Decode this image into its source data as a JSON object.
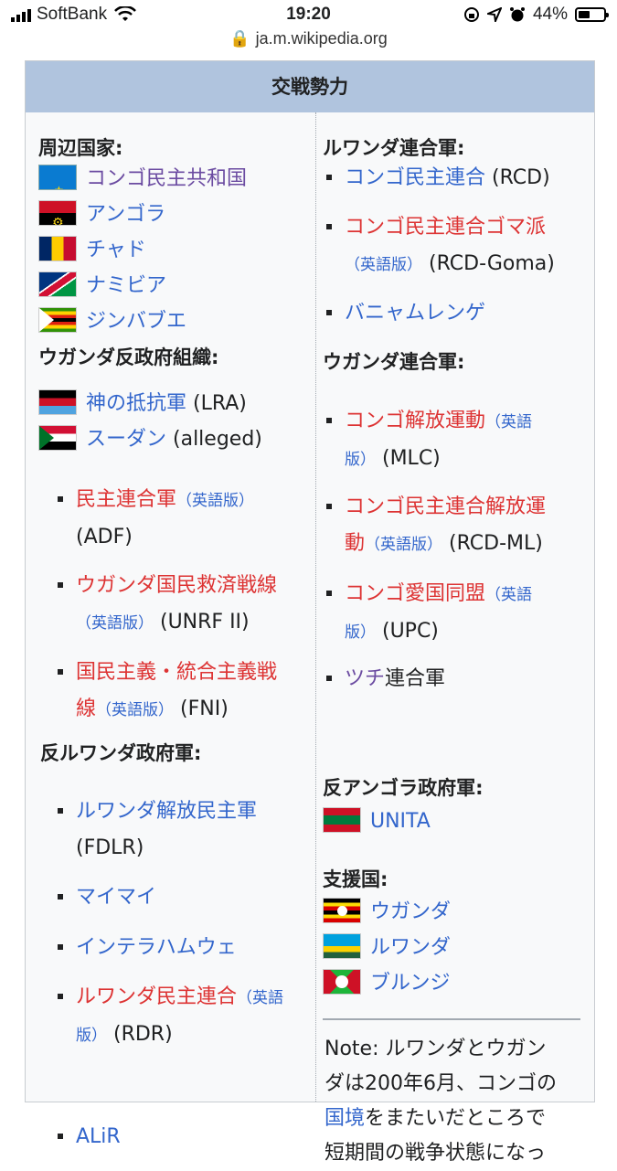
{
  "statusbar": {
    "carrier": "SoftBank",
    "time": "19:20",
    "battery": "44%",
    "url": "ja.m.wikipedia.org"
  },
  "infobox": {
    "header": "交戦勢力",
    "left": {
      "neighbors_header": "周辺国家:",
      "neighbors": [
        {
          "name": "コンゴ民主共和国",
          "flag": "drc-flag"
        },
        {
          "name": "アンゴラ",
          "flag": "angola-flag"
        },
        {
          "name": "チャド",
          "flag": "chad-flag"
        },
        {
          "name": "ナミビア",
          "flag": "namibia-flag"
        },
        {
          "name": "ジンバブエ",
          "flag": "zimbabwe-flag"
        }
      ],
      "ugandan_rebels_header": "ウガンダ反政府組織:",
      "lra": {
        "name": "神の抵抗軍",
        "suffix": " (LRA)"
      },
      "sudan": {
        "name": "スーダン",
        "suffix": " (alleged)"
      },
      "adf": {
        "line1": "民主連合軍",
        "en": "（英語版）",
        "line2": "(ADF)"
      },
      "unrf": {
        "line1": "ウガンダ国民救済戦線",
        "en": "（英語版）",
        "line2": " (UNRF II)"
      },
      "fni": {
        "line1": "国民主義・統合主義戦",
        "line2": "線",
        "en": "（英語版）",
        "tail": " (FNI)"
      },
      "anti_rwanda_header": "反ルワンダ政府軍:",
      "fdlr": {
        "line1": "ルワンダ解放民主軍",
        "line2": "(FDLR)"
      },
      "maimai": "マイマイ",
      "interahamwe": "インテラハムウェ",
      "rdr": {
        "line1": "ルワンダ民主連合",
        "en1": "（英語",
        "en2": "版）",
        "tail": " (RDR)"
      },
      "alir": "ALiR"
    },
    "right": {
      "rwanda_coalition_header": "ルワンダ連合軍:",
      "rcd": {
        "name": "コンゴ民主連合",
        "suffix": " (RCD)"
      },
      "rcd_goma": {
        "line1": "コンゴ民主連合ゴマ派",
        "en": "（英語版）",
        "tail": " (RCD-Goma)"
      },
      "banyamulenge": "バニャムレンゲ",
      "uganda_coalition_header": "ウガンダ連合軍:",
      "mlc": {
        "line1": "コンゴ解放運動",
        "en1": "（英語",
        "en2": "版）",
        "tail": " (MLC)"
      },
      "rcd_ml": {
        "line1": "コンゴ民主連合解放運",
        "line2": "動",
        "en": "（英語版）",
        "tail": " (RCD-ML)"
      },
      "upc": {
        "line1": "コンゴ愛国同盟",
        "en1": "（英語",
        "en2": "版）",
        "tail": " (UPC)"
      },
      "tutsi": {
        "link": "ツチ",
        "text": "連合軍"
      },
      "anti_angola_header": "反アンゴラ政府軍:",
      "unita": "UNITA",
      "supporters_header": "支援国:",
      "supporters": [
        {
          "name": "ウガンダ",
          "flag": "uganda-flag"
        },
        {
          "name": "ルワンダ",
          "flag": "rwanda-flag"
        },
        {
          "name": "ブルンジ",
          "flag": "burundi-flag"
        }
      ],
      "note": {
        "line1": "Note: ルワンダとウガン",
        "line2": "ダは200年6月、コンゴの",
        "link": "国境",
        "line3": "をまたいだところで",
        "line4": "短期間の戦争状態になっ"
      }
    }
  }
}
